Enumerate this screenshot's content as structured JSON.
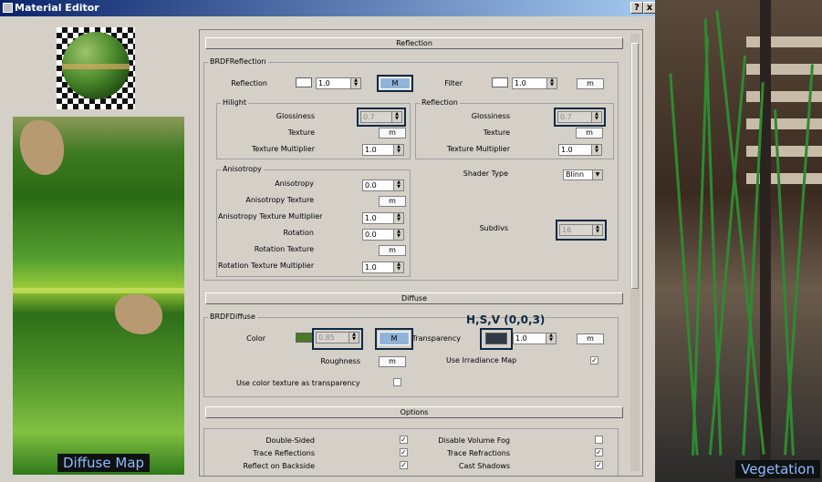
{
  "window": {
    "title": "Material Editor",
    "help_label": "?",
    "close_label": "x"
  },
  "captions": {
    "diffuse": "Diffuse Map",
    "vegetation": "Vegetation"
  },
  "annotation": "H,S,V (0,0,3)",
  "reflection_section": {
    "title": "Reflection",
    "group_title": "BRDFReflection",
    "reflection_label": "Reflection",
    "reflection_value": "1.0",
    "reflection_map": "M",
    "filter_label": "Filter",
    "filter_value": "1.0",
    "filter_map": "m",
    "hilight": {
      "title": "Hilight",
      "glossiness_label": "Glossiness",
      "glossiness_value": "0.7",
      "texture_label": "Texture",
      "texture_button": "m",
      "texmult_label": "Texture Multiplier",
      "texmult_value": "1.0"
    },
    "reflection_sub": {
      "title": "Reflection",
      "glossiness_label": "Glossiness",
      "glossiness_value": "0.7",
      "texture_label": "Texture",
      "texture_button": "m",
      "texmult_label": "Texture Multiplier",
      "texmult_value": "1.0"
    },
    "anisotropy": {
      "title": "Anisotropy",
      "anisotropy_label": "Anisotropy",
      "anisotropy_value": "0.0",
      "aniso_tex_label": "Anisotropy Texture",
      "aniso_tex_button": "m",
      "aniso_texmult_label": "Anisotropy Texture Multiplier",
      "aniso_texmult_value": "1.0",
      "rotation_label": "Rotation",
      "rotation_value": "0.0",
      "rot_tex_label": "Rotation Texture",
      "rot_tex_button": "m",
      "rot_texmult_label": "Rotation Texture Multiplier",
      "rot_texmult_value": "1.0"
    },
    "shader_type_label": "Shader Type",
    "shader_type_value": "Blinn",
    "subdivs_label": "Subdivs",
    "subdivs_value": "16"
  },
  "diffuse_section": {
    "title": "Diffuse",
    "group_title": "BRDFDiffuse",
    "color_label": "Color",
    "color_value": "0.85",
    "color_map": "M",
    "transparency_label": "Transparency",
    "transparency_value": "1.0",
    "transparency_map": "m",
    "roughness_label": "Roughness",
    "roughness_button": "m",
    "irradiance_label": "Use Irradiance Map",
    "color_tex_transp_label": "Use color texture as transparency"
  },
  "options_section": {
    "title": "Options",
    "left": [
      {
        "label": "Double-Sided",
        "check": "✓"
      },
      {
        "label": "Trace Reflections",
        "check": "✓"
      },
      {
        "label": "Reflect on Backside",
        "check": "✓"
      }
    ],
    "right": [
      {
        "label": "Disable Volume Fog",
        "check": ""
      },
      {
        "label": "Trace Refractions",
        "check": "✓"
      },
      {
        "label": "Cast Shadows",
        "check": "✓"
      }
    ]
  },
  "colors": {
    "highlight_border": "#0e2a44",
    "highlight_fill": "#8fb3d9",
    "diffuse_swatch": "#4a7a28",
    "transparency_swatch": "#2e3a46"
  },
  "icons": {
    "spinner": "up-down-arrows-icon",
    "dropdown": "chevron-down-icon",
    "check": "checkmark-icon"
  }
}
